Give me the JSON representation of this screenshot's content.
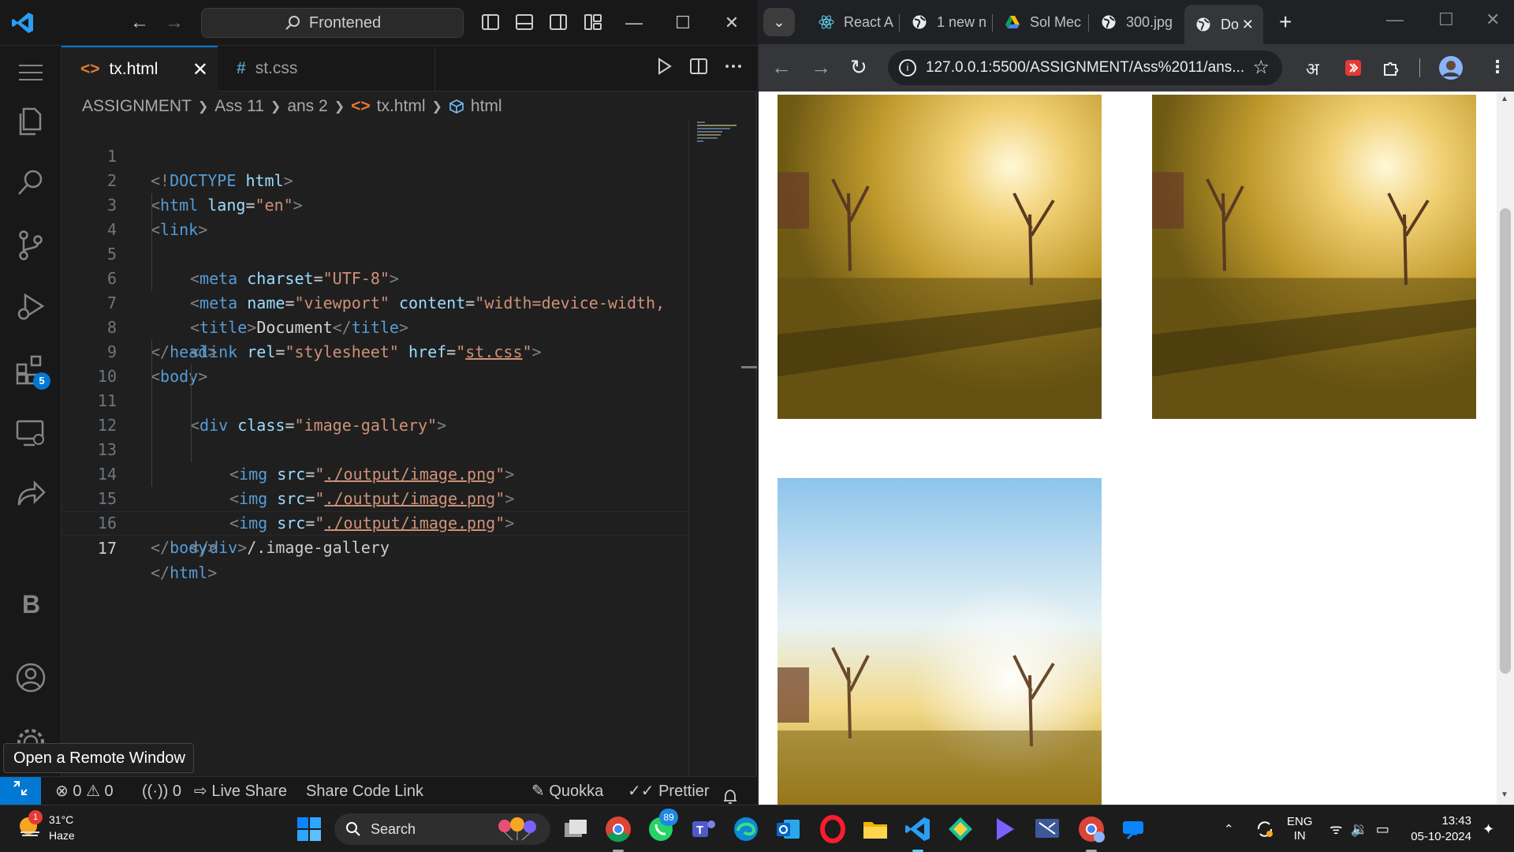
{
  "vscode": {
    "command_center": "Frontened",
    "tabs": [
      {
        "label": "tx.html",
        "icon": "<>",
        "active": true
      },
      {
        "label": "st.css",
        "icon": "#",
        "active": false
      }
    ],
    "breadcrumb": [
      "ASSIGNMENT",
      "Ass 11",
      "ans 2",
      "tx.html",
      "html"
    ],
    "extensions_badge": "5",
    "activity_letter": "B",
    "line_numbers": [
      "1",
      "2",
      "3",
      "4",
      "5",
      "6",
      "7",
      "8",
      "9",
      "10",
      "11",
      "12",
      "13",
      "14",
      "15",
      "16",
      "17"
    ],
    "code": {
      "l1": {
        "open": "<!",
        "kw": "DOCTYPE",
        "sp": " ",
        "attr": "html",
        "close": ">"
      },
      "l2": {
        "open": "<",
        "tag": "html",
        "sp": " ",
        "attr": "lang",
        "eq": "=",
        "val": "\"en\"",
        "close": ">"
      },
      "l3": {
        "open": "<",
        "tag": "link",
        "close": ">"
      },
      "l4": {
        "open": "<",
        "tag": "meta",
        "sp": " ",
        "attr": "charset",
        "eq": "=",
        "val": "\"UTF-8\"",
        "close": ">"
      },
      "l5": {
        "open": "<",
        "tag": "meta",
        "sp": " ",
        "attr": "name",
        "eq": "=",
        "val": "\"viewport\"",
        "sp2": " ",
        "attr2": "content",
        "eq2": "=",
        "val2": "\"width=device-width,"
      },
      "l6": {
        "open": "<",
        "tag": "title",
        "close": ">",
        "text": "Document",
        "open2": "</",
        "tag2": "title",
        "close2": ">"
      },
      "l7": {
        "open": "<",
        "tag": "link",
        "sp": " ",
        "attr": "rel",
        "eq": "=",
        "val": "\"stylesheet\"",
        "sp2": " ",
        "attr2": "href",
        "eq2": "=",
        "q1": "\"",
        "link": "st.css",
        "q2": "\"",
        "close": ">"
      },
      "l8": {
        "open": "</",
        "tag": "head",
        "close": ">"
      },
      "l9": {
        "open": "<",
        "tag": "body",
        "close": ">"
      },
      "l10": {
        "open": "<",
        "tag": "div",
        "sp": " ",
        "attr": "class",
        "eq": "=",
        "val": "\"image-gallery\"",
        "close": ">"
      },
      "img": {
        "open": "<",
        "tag": "img",
        "sp": " ",
        "attr": "src",
        "eq": "=",
        "q1": "\"",
        "link": "./output/image.png",
        "q2": "\"",
        "close": ">"
      },
      "l15": {
        "open": "</",
        "tag": "div",
        "close": ">",
        "comment": "/.image-gallery"
      },
      "l16": {
        "open": "</",
        "tag": "body",
        "close": ">"
      },
      "l17": {
        "open": "</",
        "tag": "html",
        "close": ">"
      }
    },
    "tooltip": "Open a Remote Window",
    "status": {
      "errors": "0",
      "warnings": "0",
      "ports": "0",
      "live_share": "Live Share",
      "share_code_link": "Share Code Link",
      "quokka": "Quokka",
      "prettier": "Prettier"
    }
  },
  "chrome": {
    "tabs": [
      {
        "label": "React A",
        "icon": "react-icon"
      },
      {
        "label": "1 new n",
        "icon": "globe-icon"
      },
      {
        "label": "Sol Mec",
        "icon": "drive-icon"
      },
      {
        "label": "300.jpg",
        "icon": "globe-icon"
      },
      {
        "label": "Do",
        "icon": "globe-icon",
        "active": true
      }
    ],
    "url": "127.0.0.1:5500/ASSIGNMENT/Ass%2011/ans...",
    "ext_hindi": "अ"
  },
  "taskbar": {
    "weather_temp": "31°C",
    "weather_desc": "Haze",
    "weather_badge": "1",
    "search_label": "Search",
    "whatsapp_badge": "89",
    "lang_top": "ENG",
    "lang_bottom": "IN",
    "time": "13:43",
    "date": "05-10-2024"
  },
  "colors": {
    "accent": "#0078d4",
    "editor_bg": "#1f1f1f",
    "tag": "#569cd6",
    "attr": "#9cdcfe",
    "string": "#ce9178"
  }
}
